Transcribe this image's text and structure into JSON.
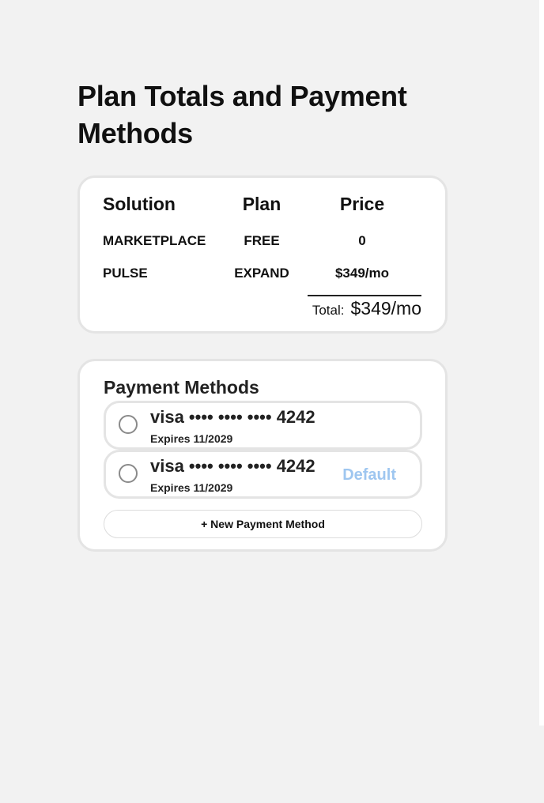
{
  "page": {
    "title": "Plan Totals and Payment Methods"
  },
  "totals": {
    "headers": {
      "solution": "Solution",
      "plan": "Plan",
      "price": "Price"
    },
    "rows": [
      {
        "solution": "MARKETPLACE",
        "plan": "FREE",
        "price": "0"
      },
      {
        "solution": "PULSE",
        "plan": "EXPAND",
        "price": "$349/mo"
      }
    ],
    "total_label": "Total:",
    "total_value": "$349/mo"
  },
  "payment": {
    "title": "Payment Methods",
    "methods": [
      {
        "brand": "visa",
        "masked": "•••• •••• ••••",
        "last4": "4242",
        "number_display": "visa •••• •••• •••• 4242",
        "expires": "Expires 11/2029",
        "badge": ""
      },
      {
        "brand": "visa",
        "masked": "•••• •••• ••••",
        "last4": "4242",
        "number_display": "visa •••• •••• •••• 4242",
        "expires": "Expires 11/2029",
        "badge": "Default"
      }
    ],
    "new_button_label": "+ New Payment Method"
  },
  "colors": {
    "background": "#f2f2f2",
    "card_border": "#e4e4e4",
    "default_badge": "#9ec6f0"
  }
}
